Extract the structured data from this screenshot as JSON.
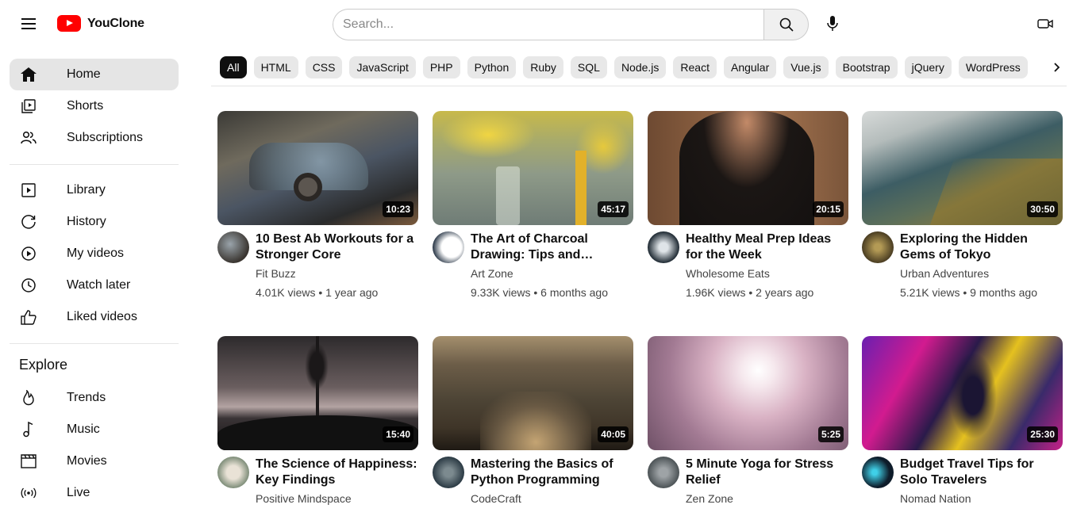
{
  "app": {
    "name": "YouClone"
  },
  "search": {
    "placeholder": "Search..."
  },
  "sidebar": {
    "main": [
      {
        "label": "Home",
        "icon": "home-icon",
        "active": true
      },
      {
        "label": "Shorts",
        "icon": "shorts-icon"
      },
      {
        "label": "Subscriptions",
        "icon": "subscriptions-icon"
      }
    ],
    "library": [
      {
        "label": "Library",
        "icon": "library-icon"
      },
      {
        "label": "History",
        "icon": "history-icon"
      },
      {
        "label": "My videos",
        "icon": "my-videos-icon"
      },
      {
        "label": "Watch later",
        "icon": "watch-later-icon"
      },
      {
        "label": "Liked videos",
        "icon": "liked-videos-icon"
      }
    ],
    "explore_title": "Explore",
    "explore": [
      {
        "label": "Trends",
        "icon": "trends-icon"
      },
      {
        "label": "Music",
        "icon": "music-icon"
      },
      {
        "label": "Movies",
        "icon": "movies-icon"
      },
      {
        "label": "Live",
        "icon": "live-icon"
      }
    ]
  },
  "chips": [
    "All",
    "HTML",
    "CSS",
    "JavaScript",
    "PHP",
    "Python",
    "Ruby",
    "SQL",
    "Node.js",
    "React",
    "Angular",
    "Vue.js",
    "Bootstrap",
    "jQuery",
    "WordPress"
  ],
  "videos": [
    {
      "title": "10 Best Ab Workouts for a Stronger Core",
      "channel": "Fit Buzz",
      "views": "4.01K views",
      "age": "1 year ago",
      "duration": "10:23"
    },
    {
      "title": "The Art of Charcoal Drawing: Tips and Techniques",
      "channel": "Art Zone",
      "views": "9.33K views",
      "age": "6 months ago",
      "duration": "45:17"
    },
    {
      "title": "Healthy Meal Prep Ideas for the Week",
      "channel": "Wholesome Eats",
      "views": "1.96K views",
      "age": "2 years ago",
      "duration": "20:15"
    },
    {
      "title": "Exploring the Hidden Gems of Tokyo",
      "channel": "Urban Adventures",
      "views": "5.21K views",
      "age": "9 months ago",
      "duration": "30:50"
    },
    {
      "title": "The Science of Happiness: Key Findings",
      "channel": "Positive Mindspace",
      "views": "",
      "age": "",
      "duration": "15:40"
    },
    {
      "title": "Mastering the Basics of Python Programming",
      "channel": "CodeCraft",
      "views": "",
      "age": "",
      "duration": "40:05"
    },
    {
      "title": "5 Minute Yoga for Stress Relief",
      "channel": "Zen Zone",
      "views": "",
      "age": "",
      "duration": "5:25"
    },
    {
      "title": "Budget Travel Tips for Solo Travelers",
      "channel": "Nomad Nation",
      "views": "",
      "age": "",
      "duration": "25:30"
    }
  ],
  "colors": {
    "brand": "#ff0000",
    "active_chip": "#0f0f0f",
    "chip_bg": "#e8e8e8"
  }
}
